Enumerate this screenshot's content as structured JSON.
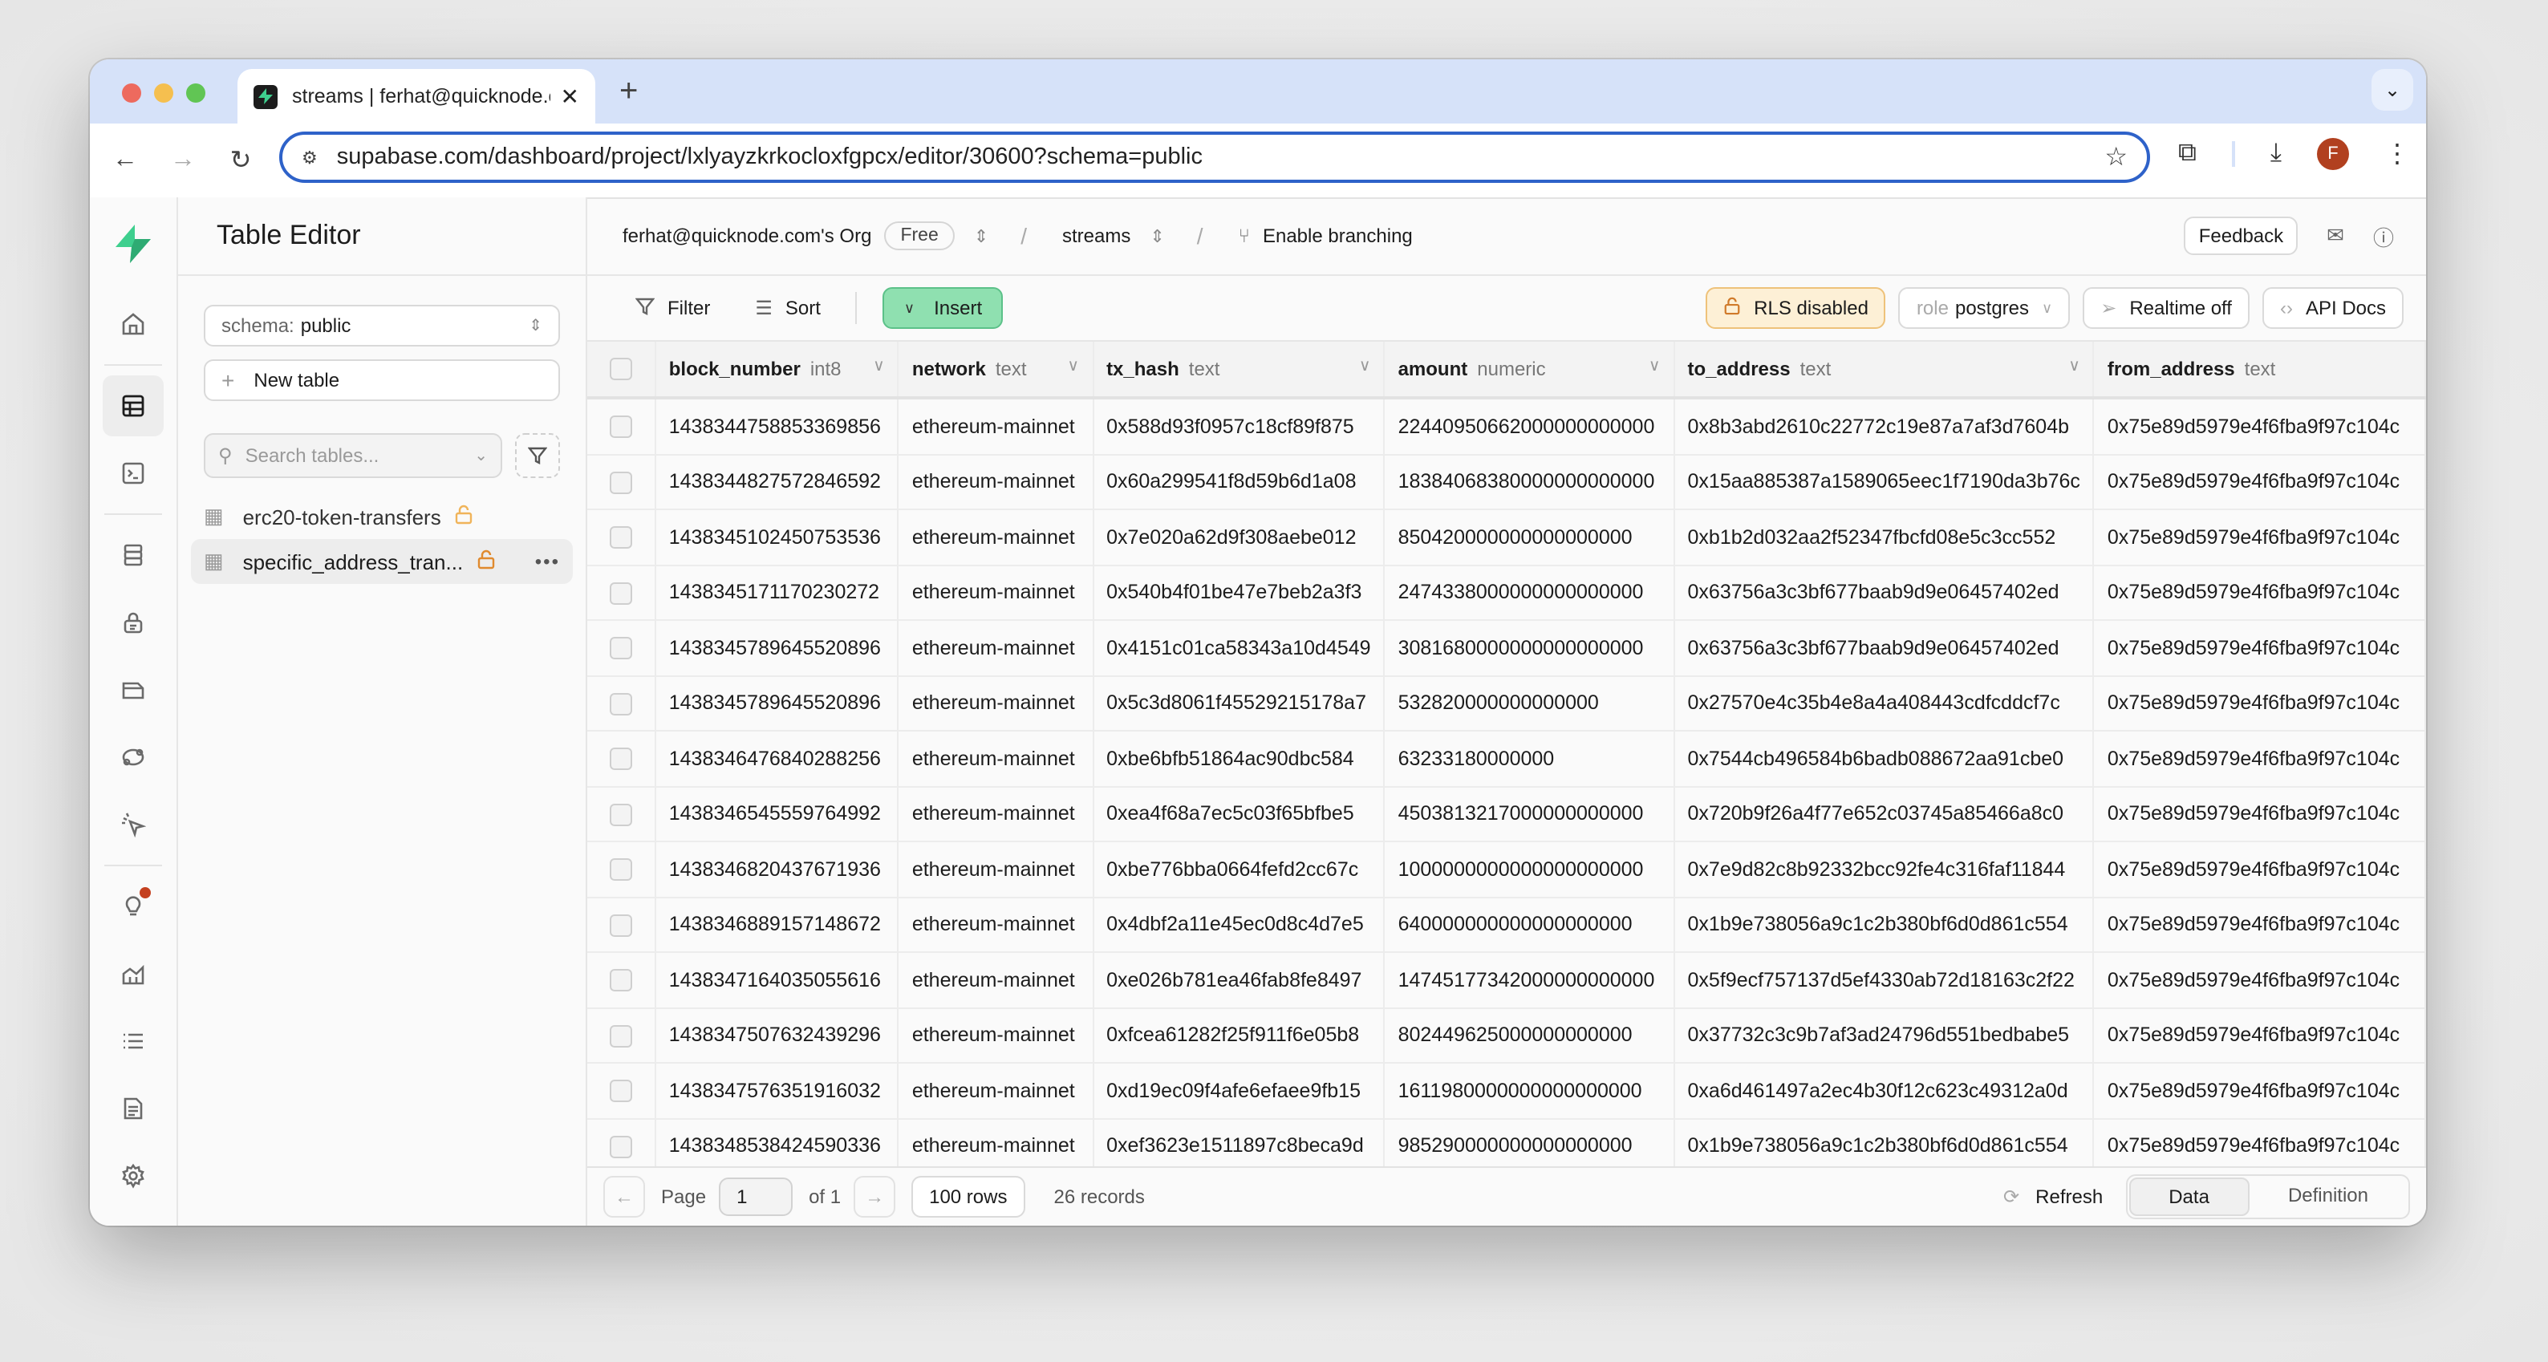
{
  "browser": {
    "tab_title": "streams | ferhat@quicknode.com's Org",
    "url": "supabase.com/dashboard/project/lxlyayzkrkocloxfgpcx/editor/30600?schema=public",
    "avatar_initial": "F"
  },
  "rail": {
    "items": [
      {
        "icon": "home-icon",
        "label": "Home"
      },
      {
        "icon": "table-editor-icon",
        "label": "Table Editor",
        "active": true
      },
      {
        "icon": "sql-editor-icon",
        "label": "SQL Editor"
      },
      {
        "icon": "database-icon",
        "label": "Database"
      },
      {
        "icon": "auth-lock-icon",
        "label": "Authentication"
      },
      {
        "icon": "storage-folder-icon",
        "label": "Storage"
      },
      {
        "icon": "edge-functions-icon",
        "label": "Edge Functions"
      },
      {
        "icon": "realtime-cursor-icon",
        "label": "Realtime"
      },
      {
        "icon": "advisors-bulb-icon",
        "label": "Advisors"
      },
      {
        "icon": "reports-chart-icon",
        "label": "Reports"
      },
      {
        "icon": "logs-list-icon",
        "label": "Logs"
      },
      {
        "icon": "api-docs-icon",
        "label": "API Docs"
      },
      {
        "icon": "settings-gear-icon",
        "label": "Project Settings"
      }
    ]
  },
  "sidebar": {
    "title": "Table Editor",
    "schema_label": "schema:",
    "schema_value": "public",
    "new_table_label": "New table",
    "search_placeholder": "Search tables...",
    "tables": [
      {
        "name": "erc20-token-transfers",
        "active": false
      },
      {
        "name": "specific_address_tran...",
        "active": true
      }
    ]
  },
  "topbar": {
    "org": "ferhat@quicknode.com's Org",
    "plan_badge": "Free",
    "project": "streams",
    "branching": "Enable branching",
    "feedback": "Feedback"
  },
  "actionbar": {
    "filter": "Filter",
    "sort": "Sort",
    "insert": "Insert",
    "rls": "RLS disabled",
    "role_label": "role",
    "role_value": "postgres",
    "realtime": "Realtime off",
    "api_docs": "API Docs"
  },
  "grid": {
    "columns": [
      {
        "name": "block_number",
        "type": "int8"
      },
      {
        "name": "network",
        "type": "text"
      },
      {
        "name": "tx_hash",
        "type": "text"
      },
      {
        "name": "amount",
        "type": "numeric"
      },
      {
        "name": "to_address",
        "type": "text"
      },
      {
        "name": "from_address",
        "type": "text"
      }
    ],
    "rows": [
      [
        "1438344758853369856",
        "ethereum-mainnet",
        "0x588d93f0957c18cf89f875",
        "22440950662000000000000",
        "0x8b3abd2610c22772c19e87a7af3d7604b",
        "0x75e89d5979e4f6fba9f97c104c"
      ],
      [
        "1438344827572846592",
        "ethereum-mainnet",
        "0x60a299541f8d59b6d1a08",
        "18384068380000000000000",
        "0x15aa885387a1589065eec1f7190da3b76c",
        "0x75e89d5979e4f6fba9f97c104c"
      ],
      [
        "1438345102450753536",
        "ethereum-mainnet",
        "0x7e020a62d9f308aebe012",
        "850420000000000000000",
        "0xb1b2d032aa2f52347fbcfd08e5c3cc552",
        "0x75e89d5979e4f6fba9f97c104c"
      ],
      [
        "1438345171170230272",
        "ethereum-mainnet",
        "0x540b4f01be47e7beb2a3f3",
        "2474338000000000000000",
        "0x63756a3c3bf677baab9d9e06457402ed",
        "0x75e89d5979e4f6fba9f97c104c"
      ],
      [
        "1438345789645520896",
        "ethereum-mainnet",
        "0x4151c01ca58343a10d4549",
        "3081680000000000000000",
        "0x63756a3c3bf677baab9d9e06457402ed",
        "0x75e89d5979e4f6fba9f97c104c"
      ],
      [
        "1438345789645520896",
        "ethereum-mainnet",
        "0x5c3d8061f45529215178a7",
        "532820000000000000",
        "0x27570e4c35b4e8a4a408443cdfcddcf7c",
        "0x75e89d5979e4f6fba9f97c104c"
      ],
      [
        "1438346476840288256",
        "ethereum-mainnet",
        "0xbe6bfb51864ac90dbc584",
        "63233180000000",
        "0x7544cb496584b6badb088672aa91cbe0",
        "0x75e89d5979e4f6fba9f97c104c"
      ],
      [
        "1438346545559764992",
        "ethereum-mainnet",
        "0xea4f68a7ec5c03f65bfbe5",
        "4503813217000000000000",
        "0x720b9f26a4f77e652c03745a85466a8c0",
        "0x75e89d5979e4f6fba9f97c104c"
      ],
      [
        "1438346820437671936",
        "ethereum-mainnet",
        "0xbe776bba0664fefd2cc67c",
        "1000000000000000000000",
        "0x7e9d82c8b92332bcc92fe4c316faf11844",
        "0x75e89d5979e4f6fba9f97c104c"
      ],
      [
        "1438346889157148672",
        "ethereum-mainnet",
        "0x4dbf2a11e45ec0d8c4d7e5",
        "640000000000000000000",
        "0x1b9e738056a9c1c2b380bf6d0d861c554",
        "0x75e89d5979e4f6fba9f97c104c"
      ],
      [
        "1438347164035055616",
        "ethereum-mainnet",
        "0xe026b781ea46fab8fe8497",
        "14745177342000000000000",
        "0x5f9ecf757137d5ef4330ab72d18163c2f22",
        "0x75e89d5979e4f6fba9f97c104c"
      ],
      [
        "1438347507632439296",
        "ethereum-mainnet",
        "0xfcea61282f25f911f6e05b8",
        "802449625000000000000",
        "0x37732c3c9b7af3ad24796d551bedbabe5",
        "0x75e89d5979e4f6fba9f97c104c"
      ],
      [
        "1438347576351916032",
        "ethereum-mainnet",
        "0xd19ec09f4afe6efaee9fb15",
        "1611980000000000000000",
        "0xa6d461497a2ec4b30f12c623c49312a0d",
        "0x75e89d5979e4f6fba9f97c104c"
      ],
      [
        "1438348538424590336",
        "ethereum-mainnet",
        "0xef3623e1511897c8beca9d",
        "985290000000000000000",
        "0x1b9e738056a9c1c2b380bf6d0d861c554",
        "0x75e89d5979e4f6fba9f97c104c"
      ]
    ]
  },
  "footer": {
    "page_label": "Page",
    "page_value": "1",
    "of_label": "of 1",
    "rows_per_page": "100 rows",
    "record_count": "26 records",
    "refresh": "Refresh",
    "view_data": "Data",
    "view_definition": "Definition"
  },
  "colors": {
    "brand_green": "#3ecf8e",
    "insert_bg": "#8fe0b0",
    "rls_warning_bg": "#fdf0d6",
    "lock_orange": "#e08a2e",
    "url_focus": "#2e62c9"
  }
}
